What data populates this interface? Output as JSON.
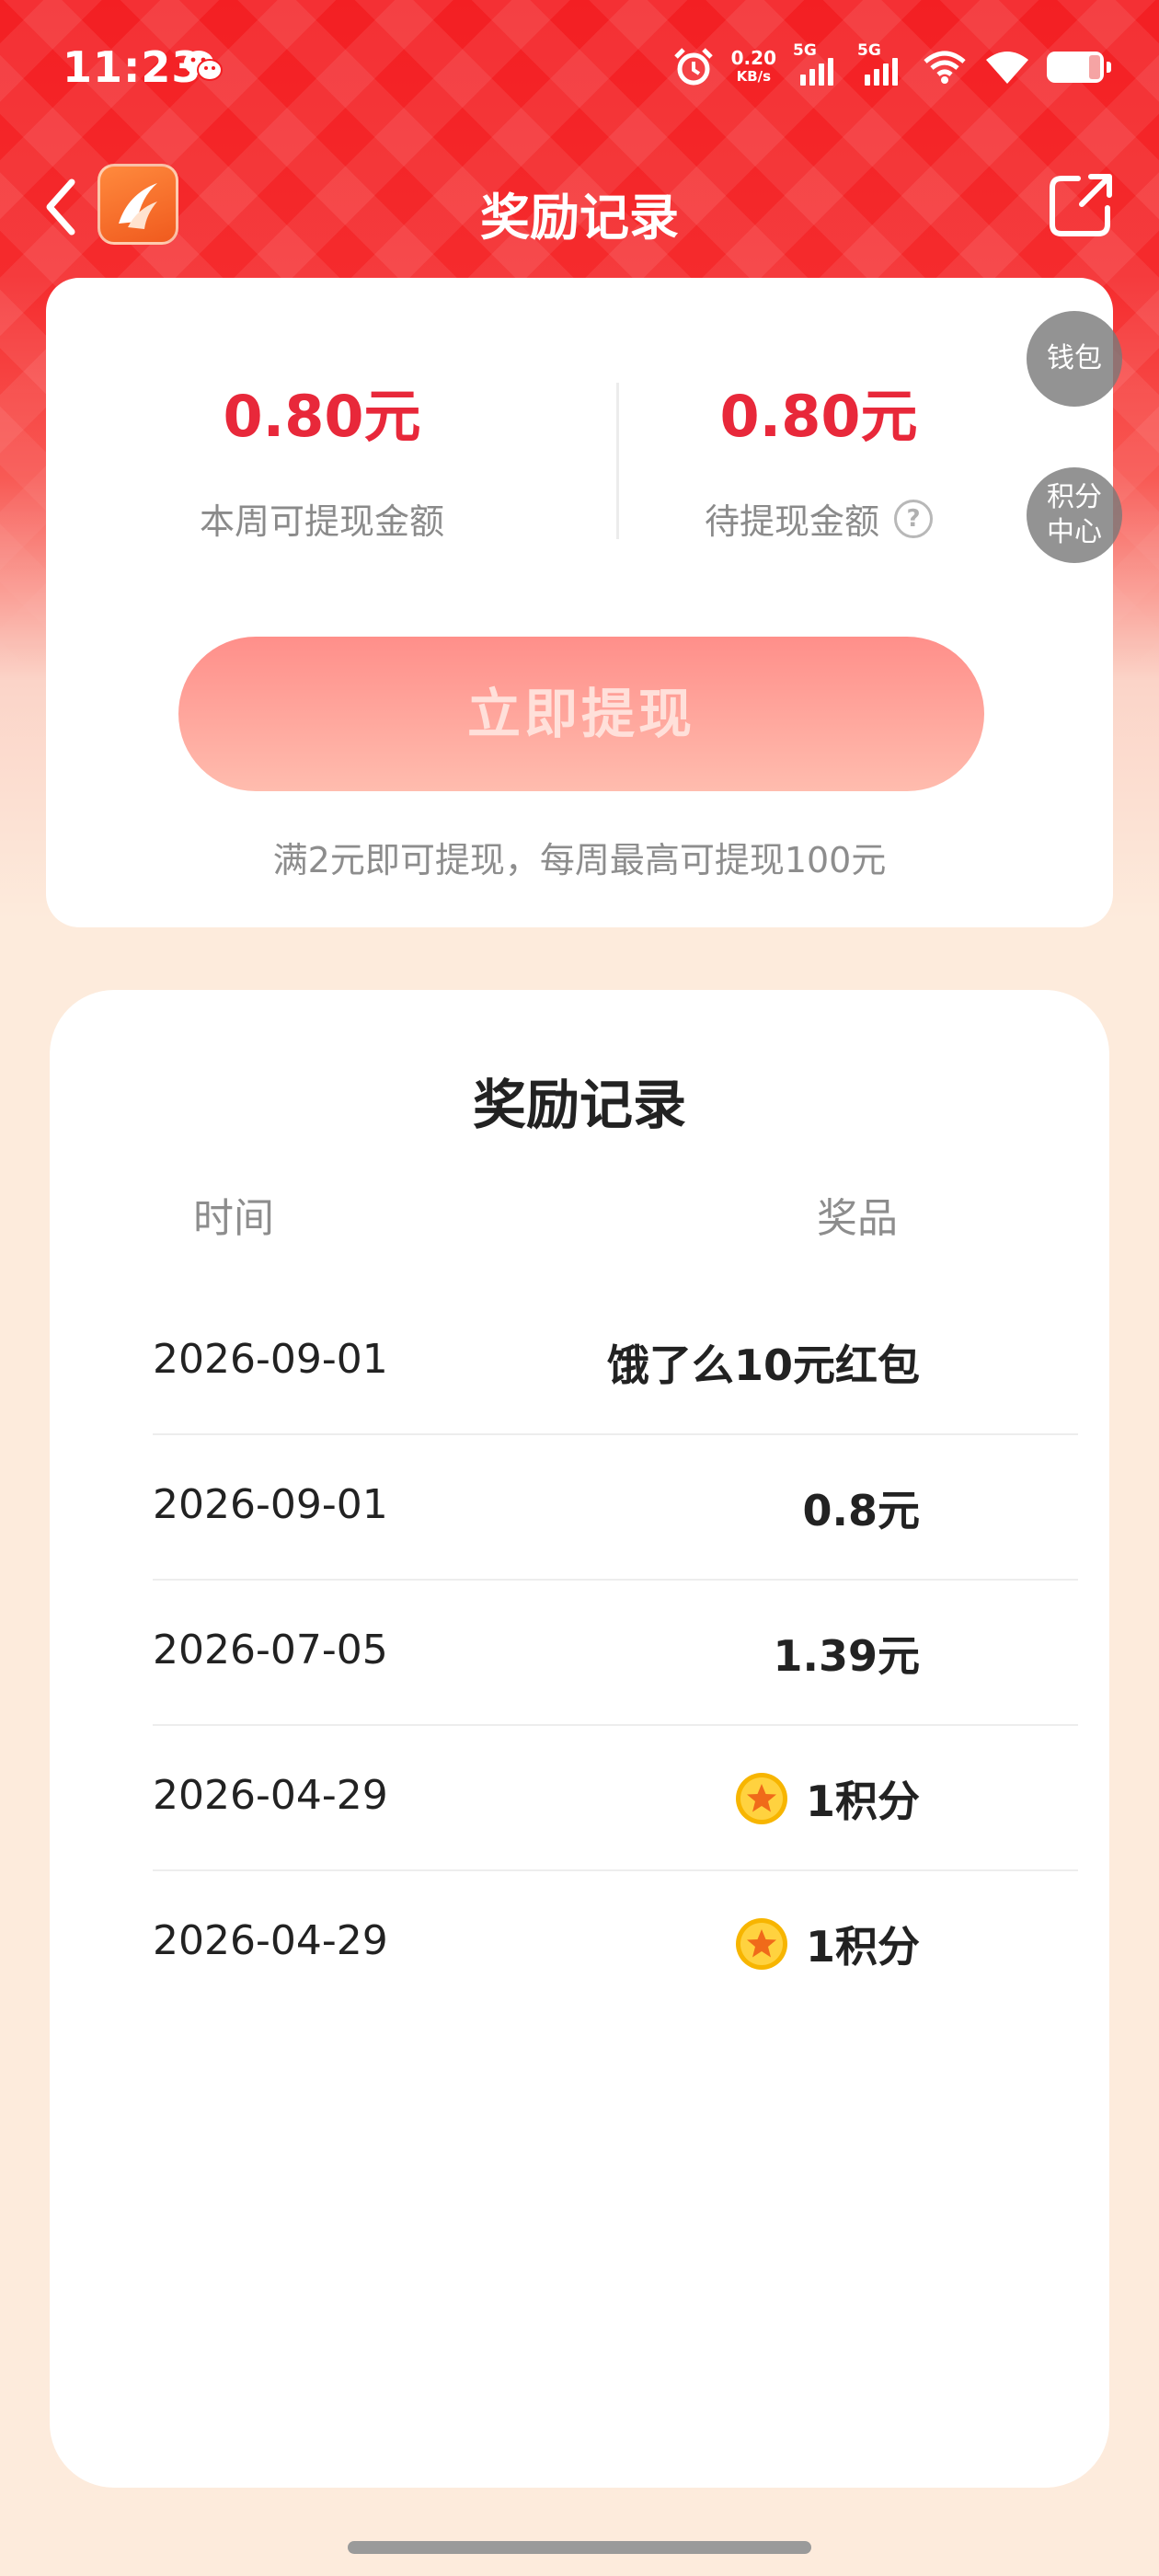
{
  "status_bar": {
    "time": "11:23",
    "net_speed_value": "0.20",
    "net_speed_unit": "KB/s",
    "signal_1_label": "5G",
    "signal_2_label": "5G"
  },
  "nav": {
    "title": "奖励记录"
  },
  "summary": {
    "weekly_amount": "0.80元",
    "weekly_label": "本周可提现金额",
    "pending_amount": "0.80元",
    "pending_label": "待提现金额",
    "withdraw_button": "立即提现",
    "tip": "满2元即可提现，每周最高可提现100元"
  },
  "floating": {
    "wallet": "钱包",
    "points_line1": "积分",
    "points_line2": "中心"
  },
  "records": {
    "title": "奖励记录",
    "col_time": "时间",
    "col_prize": "奖品",
    "rows": [
      {
        "date": "2026-09-01",
        "prize": "饿了么10元红包"
      },
      {
        "date": "2026-09-01",
        "prize": "0.8元"
      },
      {
        "date": "2026-07-05",
        "prize": "1.39元"
      },
      {
        "date": "2026-04-29",
        "prize": "1积分",
        "icon": "star-coin-icon"
      },
      {
        "date": "2026-04-29",
        "prize": "1积分",
        "icon": "star-coin-icon"
      }
    ]
  },
  "colors": {
    "brand_red": "#f31f23",
    "amount_red": "#e8283a",
    "button_pink": "#ff8f8a"
  }
}
